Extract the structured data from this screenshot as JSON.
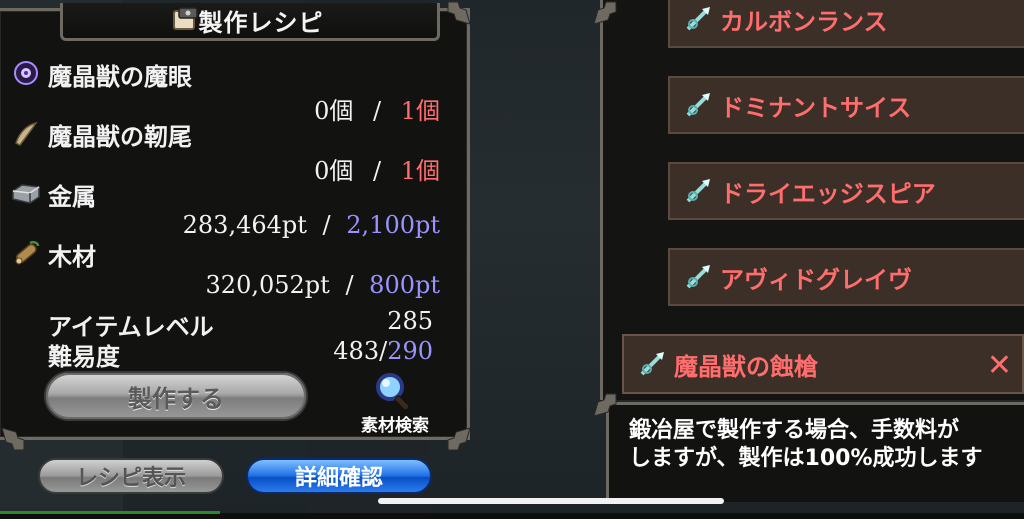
{
  "recipe": {
    "title": "製作レシピ",
    "materials": [
      {
        "name": "魔晶獣の魔眼",
        "icon": "eye-orb-icon",
        "have": "0個",
        "sep": "/",
        "need": "1個",
        "need_color": "red"
      },
      {
        "name": "魔晶獣の靭尾",
        "icon": "tail-claw-icon",
        "have": "0個",
        "sep": "/",
        "need": "1個",
        "need_color": "red"
      },
      {
        "name": "金属",
        "icon": "metal-ingot-icon",
        "have": "283,464pt",
        "sep": "/",
        "need": "2,100pt",
        "need_color": "blue"
      },
      {
        "name": "木材",
        "icon": "wood-log-icon",
        "have": "320,052pt",
        "sep": "/",
        "need": "800pt",
        "need_color": "blue"
      }
    ],
    "item_level_label": "アイテムレベル",
    "item_level_value": "285",
    "difficulty_label": "難易度",
    "difficulty_current": "483/",
    "difficulty_max": "290",
    "craft_button": "製作する",
    "search_label": "素材検索"
  },
  "bottom_buttons": {
    "recipe_view": "レシピ表示",
    "detail": "詳細確認"
  },
  "weapon_list": {
    "items": [
      {
        "label": "カルボンランス"
      },
      {
        "label": "ドミナントサイス"
      },
      {
        "label": "ドライエッジスピア"
      },
      {
        "label": "アヴィドグレイヴ"
      }
    ],
    "selected": {
      "label": "魔晶獣の蝕槍",
      "close": "✕"
    }
  },
  "description": {
    "line1": "鍛冶屋で製作する場合、手数料が",
    "line2": "しますが、製作は100%成功します"
  },
  "colors": {
    "red": "#ff6f6f",
    "blue": "#9a92ff",
    "accent_blue": "#1e6fe6"
  }
}
